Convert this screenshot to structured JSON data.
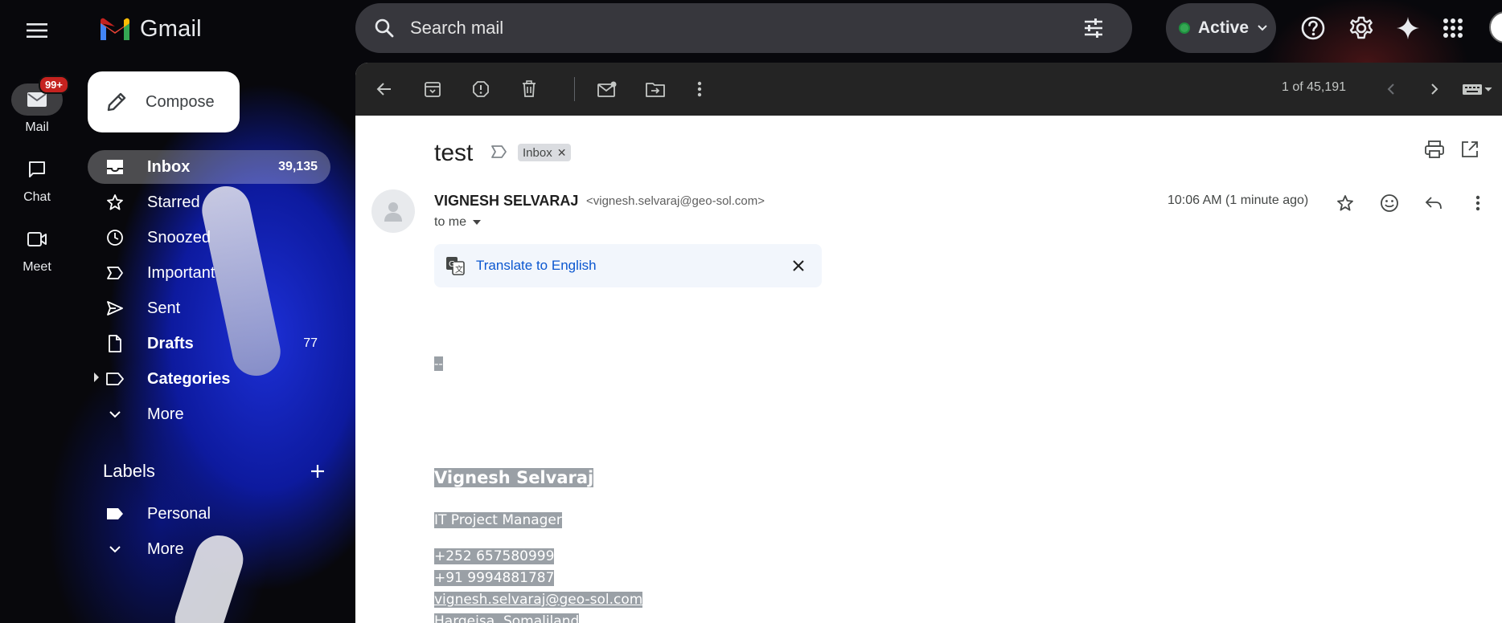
{
  "app": {
    "name": "Gmail"
  },
  "search": {
    "placeholder": "Search mail"
  },
  "status": {
    "label": "Active"
  },
  "rail": {
    "mail": {
      "label": "Mail",
      "badge": "99+"
    },
    "chat": {
      "label": "Chat"
    },
    "meet": {
      "label": "Meet"
    }
  },
  "compose": {
    "label": "Compose"
  },
  "nav": [
    {
      "label": "Inbox",
      "count": "39,135",
      "icon": "inbox-icon"
    },
    {
      "label": "Starred",
      "count": "",
      "icon": "star-icon"
    },
    {
      "label": "Snoozed",
      "count": "",
      "icon": "clock-icon"
    },
    {
      "label": "Important",
      "count": "",
      "icon": "important-icon"
    },
    {
      "label": "Sent",
      "count": "",
      "icon": "send-icon"
    },
    {
      "label": "Drafts",
      "count": "77",
      "icon": "draft-icon"
    },
    {
      "label": "Categories",
      "count": "",
      "icon": "label-icon"
    },
    {
      "label": "More",
      "count": "",
      "icon": "chevron-down-icon"
    }
  ],
  "labels": {
    "title": "Labels",
    "items": [
      {
        "label": "Personal",
        "icon": "label-filled-icon"
      },
      {
        "label": "More",
        "icon": "chevron-down-icon"
      }
    ]
  },
  "toolbar": {
    "pager": "1 of 45,191"
  },
  "message": {
    "subject": "test",
    "chip": "Inbox",
    "sender_name": "VIGNESH SELVARAJ",
    "sender_email": "<vignesh.selvaraj@geo-sol.com>",
    "to": "to me",
    "time": "10:06 AM (1 minute ago)",
    "translate": "Translate to English"
  },
  "signature": {
    "dash": "--",
    "name": "Vignesh Selvaraj",
    "title": "IT Project Manager",
    "phone1": "+252 657580999",
    "phone2": "+91 9994881787",
    "email": "vignesh.selvaraj@geo-sol.com",
    "location": "Hargeisa, Somaliland"
  }
}
